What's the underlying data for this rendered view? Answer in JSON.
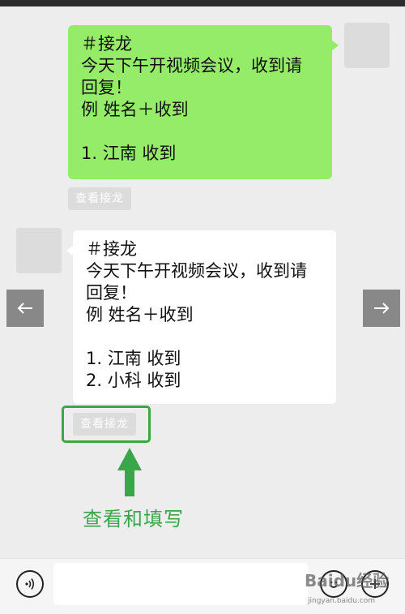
{
  "messages": [
    {
      "side": "right",
      "lines": [
        "＃接龙",
        "今天下午开视频会议，收到请",
        "回复！",
        "例 姓名＋收到",
        "",
        "1. 江南 收到"
      ],
      "action_label": "查看接龙"
    },
    {
      "side": "left",
      "lines": [
        "＃接龙",
        "今天下午开视频会议，收到请",
        "回复！",
        "例 姓名＋收到",
        "",
        "1. 江南 收到",
        "2. 小科 收到"
      ],
      "action_label": "查看接龙"
    }
  ],
  "annotation": {
    "text": "查看和填写",
    "color": "#3aa64a"
  },
  "colors": {
    "sent_bubble": "#95ec69",
    "received_bubble": "#ffffff",
    "chat_background": "#ededed"
  },
  "icons": {
    "prev": "arrow-left-icon",
    "next": "arrow-right-icon",
    "voice": "voice-icon",
    "emoji": "emoji-icon",
    "more": "plus-icon"
  },
  "watermark": {
    "logo": "Baidu经验",
    "url": "jingyan.baidu.com"
  }
}
